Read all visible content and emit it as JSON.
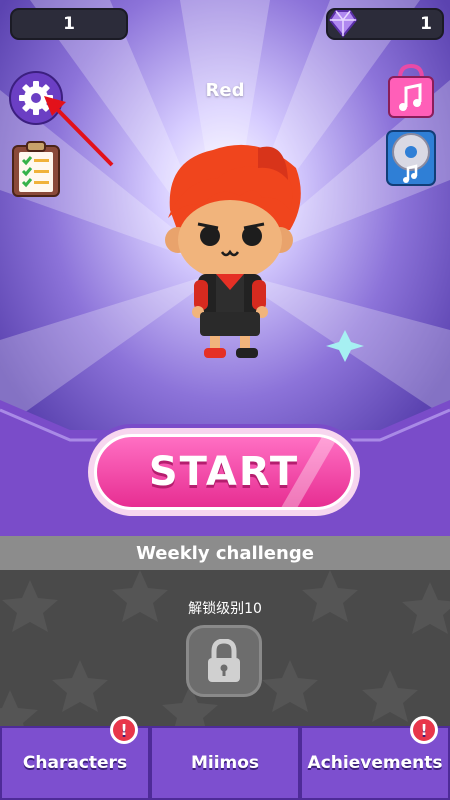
{
  "hud": {
    "coins": "1",
    "gems": "1"
  },
  "character": {
    "name": "Red"
  },
  "start_button": {
    "label": "START"
  },
  "weekly": {
    "title": "Weekly challenge",
    "unlock_text": "解锁级别10"
  },
  "tabs": [
    {
      "label": "Characters",
      "badge": "!"
    },
    {
      "label": "Miimos"
    },
    {
      "label": "Achievements",
      "badge": "!"
    }
  ],
  "colors": {
    "accent": "#e72e92",
    "bg": "#6a4fbf",
    "tab": "#7d4fcf",
    "badge": "#e8364b"
  },
  "icons": [
    "settings-gear-icon",
    "checklist-clipboard-icon",
    "music-shop-bag-icon",
    "music-disc-icon",
    "gem-icon",
    "lock-icon"
  ]
}
